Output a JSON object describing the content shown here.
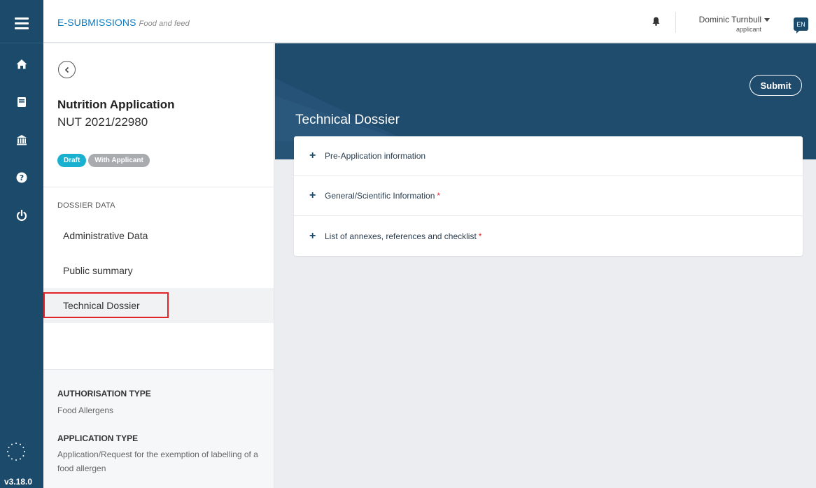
{
  "sidebar_rail": {
    "items": [
      {
        "icon": "home-icon"
      },
      {
        "icon": "book-icon"
      },
      {
        "icon": "building-icon"
      },
      {
        "icon": "help-icon"
      },
      {
        "icon": "power-icon"
      }
    ],
    "version": "v3.18.0"
  },
  "header": {
    "brand": "E-SUBMISSIONS",
    "brand_sub": "Food and feed",
    "user_name": "Dominic Turnbull",
    "user_role": "applicant",
    "language": "EN"
  },
  "application": {
    "name": "Nutrition Application",
    "id": "NUT 2021/22980",
    "badges": [
      "Draft",
      "With Applicant"
    ],
    "section_label": "DOSSIER DATA",
    "nav": [
      {
        "label": "Administrative Data"
      },
      {
        "label": "Public summary"
      },
      {
        "label": "Technical Dossier",
        "active": true
      }
    ],
    "authorisation_type_label": "AUTHORISATION TYPE",
    "authorisation_type": "Food Allergens",
    "application_type_label": "APPLICATION TYPE",
    "application_type": "Application/Request for the exemption of labelling of a food allergen"
  },
  "main": {
    "title": "Technical Dossier",
    "submit_label": "Submit",
    "sections": [
      {
        "label": "Pre-Application information",
        "required": false
      },
      {
        "label": "General/Scientific Information",
        "required": true
      },
      {
        "label": "List of annexes, references and checklist",
        "required": true
      }
    ],
    "required_mark": "*"
  },
  "colors": {
    "rail": "#1c4a6b",
    "banner": "#1f4b6d",
    "accent": "#0a7bc1",
    "draft_badge": "#1ab1d0",
    "highlight": "#e3232a"
  }
}
